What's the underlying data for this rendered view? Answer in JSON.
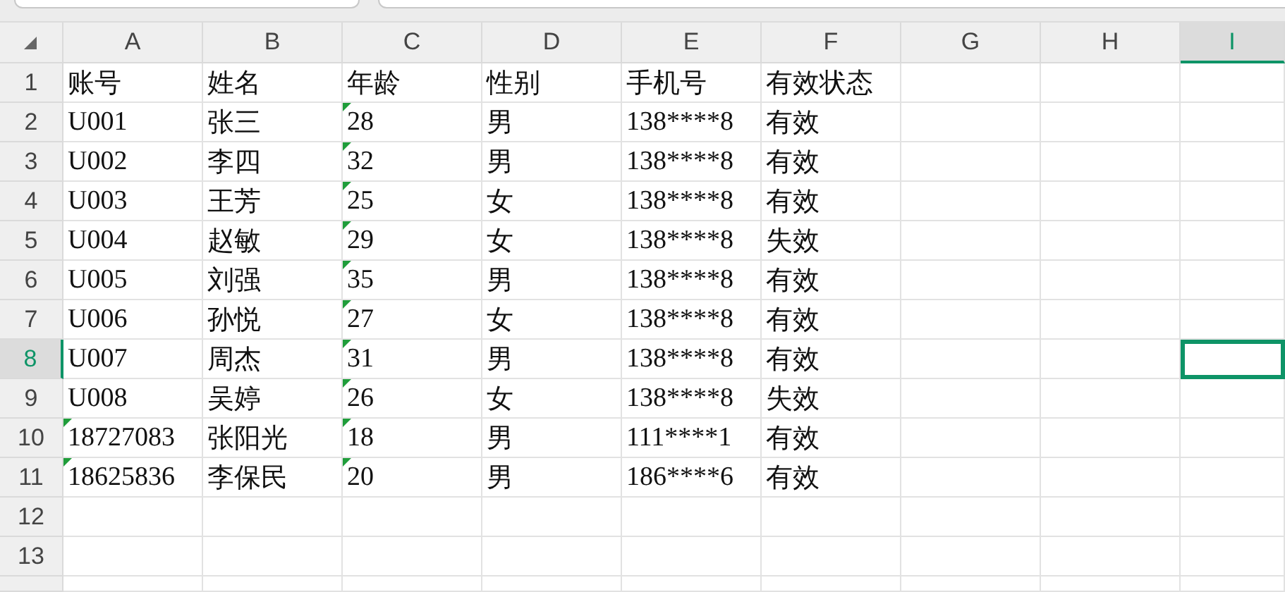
{
  "columns": [
    {
      "label": "A",
      "selected": false
    },
    {
      "label": "B",
      "selected": false
    },
    {
      "label": "C",
      "selected": false
    },
    {
      "label": "D",
      "selected": false
    },
    {
      "label": "E",
      "selected": false
    },
    {
      "label": "F",
      "selected": false
    },
    {
      "label": "G",
      "selected": false
    },
    {
      "label": "H",
      "selected": false
    },
    {
      "label": "I",
      "selected": true
    }
  ],
  "rows": [
    {
      "number": "1",
      "selected": false,
      "cells": [
        {
          "text": "账号",
          "flagged": false
        },
        {
          "text": "姓名",
          "flagged": false
        },
        {
          "text": "年龄",
          "flagged": false
        },
        {
          "text": "性别",
          "flagged": false
        },
        {
          "text": "手机号",
          "flagged": false
        },
        {
          "text": "有效状态",
          "flagged": false
        }
      ]
    },
    {
      "number": "2",
      "selected": false,
      "cells": [
        {
          "text": "U001",
          "flagged": false
        },
        {
          "text": "张三",
          "flagged": false
        },
        {
          "text": "28",
          "flagged": true
        },
        {
          "text": "男",
          "flagged": false
        },
        {
          "text": "138****8",
          "flagged": false
        },
        {
          "text": "有效",
          "flagged": false
        }
      ]
    },
    {
      "number": "3",
      "selected": false,
      "cells": [
        {
          "text": "U002",
          "flagged": false
        },
        {
          "text": "李四",
          "flagged": false
        },
        {
          "text": "32",
          "flagged": true
        },
        {
          "text": "男",
          "flagged": false
        },
        {
          "text": "138****8",
          "flagged": false
        },
        {
          "text": "有效",
          "flagged": false
        }
      ]
    },
    {
      "number": "4",
      "selected": false,
      "cells": [
        {
          "text": "U003",
          "flagged": false
        },
        {
          "text": "王芳",
          "flagged": false
        },
        {
          "text": "25",
          "flagged": true
        },
        {
          "text": "女",
          "flagged": false
        },
        {
          "text": "138****8",
          "flagged": false
        },
        {
          "text": "有效",
          "flagged": false
        }
      ]
    },
    {
      "number": "5",
      "selected": false,
      "cells": [
        {
          "text": "U004",
          "flagged": false
        },
        {
          "text": "赵敏",
          "flagged": false
        },
        {
          "text": "29",
          "flagged": true
        },
        {
          "text": "女",
          "flagged": false
        },
        {
          "text": "138****8",
          "flagged": false
        },
        {
          "text": "失效",
          "flagged": false
        }
      ]
    },
    {
      "number": "6",
      "selected": false,
      "cells": [
        {
          "text": "U005",
          "flagged": false
        },
        {
          "text": "刘强",
          "flagged": false
        },
        {
          "text": "35",
          "flagged": true
        },
        {
          "text": "男",
          "flagged": false
        },
        {
          "text": "138****8",
          "flagged": false
        },
        {
          "text": "有效",
          "flagged": false
        }
      ]
    },
    {
      "number": "7",
      "selected": false,
      "cells": [
        {
          "text": "U006",
          "flagged": false
        },
        {
          "text": "孙悦",
          "flagged": false
        },
        {
          "text": "27",
          "flagged": true
        },
        {
          "text": "女",
          "flagged": false
        },
        {
          "text": "138****8",
          "flagged": false
        },
        {
          "text": "有效",
          "flagged": false
        }
      ]
    },
    {
      "number": "8",
      "selected": true,
      "cells": [
        {
          "text": "U007",
          "flagged": false
        },
        {
          "text": "周杰",
          "flagged": false
        },
        {
          "text": "31",
          "flagged": true
        },
        {
          "text": "男",
          "flagged": false
        },
        {
          "text": "138****8",
          "flagged": false
        },
        {
          "text": "有效",
          "flagged": false
        }
      ]
    },
    {
      "number": "9",
      "selected": false,
      "cells": [
        {
          "text": "U008",
          "flagged": false
        },
        {
          "text": "吴婷",
          "flagged": false
        },
        {
          "text": "26",
          "flagged": true
        },
        {
          "text": "女",
          "flagged": false
        },
        {
          "text": "138****8",
          "flagged": false
        },
        {
          "text": "失效",
          "flagged": false
        }
      ]
    },
    {
      "number": "10",
      "selected": false,
      "cells": [
        {
          "text": "18727083",
          "flagged": true
        },
        {
          "text": "张阳光",
          "flagged": false
        },
        {
          "text": "18",
          "flagged": true
        },
        {
          "text": "男",
          "flagged": false
        },
        {
          "text": "111****1",
          "flagged": false
        },
        {
          "text": "有效",
          "flagged": false
        }
      ]
    },
    {
      "number": "11",
      "selected": false,
      "cells": [
        {
          "text": "18625836",
          "flagged": true
        },
        {
          "text": "李保民",
          "flagged": false
        },
        {
          "text": "20",
          "flagged": true
        },
        {
          "text": "男",
          "flagged": false
        },
        {
          "text": "186****6",
          "flagged": false
        },
        {
          "text": "有效",
          "flagged": false
        }
      ]
    },
    {
      "number": "12",
      "selected": false,
      "cells": []
    },
    {
      "number": "13",
      "selected": false,
      "cells": []
    }
  ]
}
